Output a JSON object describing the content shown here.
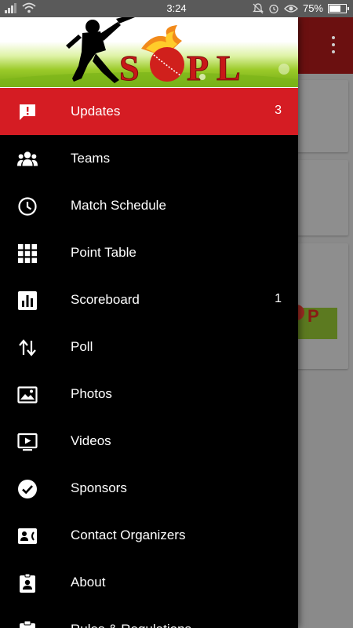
{
  "status_bar": {
    "time": "3:24",
    "battery": "75%",
    "battery_level": 0.75,
    "left_icons": [
      "signal-icon",
      "wifi-icon"
    ],
    "right_icons": [
      "notification-off-icon",
      "alarm-icon",
      "eye-icon",
      "battery-icon"
    ]
  },
  "drawer": {
    "header": {
      "logo_text": "SOPL"
    },
    "items": [
      {
        "label": "Updates",
        "icon": "message-alert-icon",
        "count": "3",
        "active": true
      },
      {
        "label": "Teams",
        "icon": "group-icon",
        "count": "",
        "active": false
      },
      {
        "label": "Match Schedule",
        "icon": "clock-icon",
        "count": "",
        "active": false
      },
      {
        "label": "Point Table",
        "icon": "grid-icon",
        "count": "",
        "active": false
      },
      {
        "label": "Scoreboard",
        "icon": "bar-chart-icon",
        "count": "1",
        "active": false
      },
      {
        "label": "Poll",
        "icon": "swap-vertical-icon",
        "count": "",
        "active": false
      },
      {
        "label": "Photos",
        "icon": "photo-icon",
        "count": "",
        "active": false
      },
      {
        "label": "Videos",
        "icon": "video-icon",
        "count": "",
        "active": false
      },
      {
        "label": "Sponsors",
        "icon": "check-circle-icon",
        "count": "",
        "active": false
      },
      {
        "label": "Contact Organizers",
        "icon": "contact-card-icon",
        "count": "",
        "active": false
      },
      {
        "label": "About",
        "icon": "badge-icon",
        "count": "",
        "active": false
      },
      {
        "label": "Rules & Regulations",
        "icon": "clipboard-icon",
        "count": "",
        "active": false
      }
    ]
  },
  "colors": {
    "accent": "#d51c23",
    "drawer_bg": "#000000",
    "toolbar_bg": "#b81c1c"
  }
}
